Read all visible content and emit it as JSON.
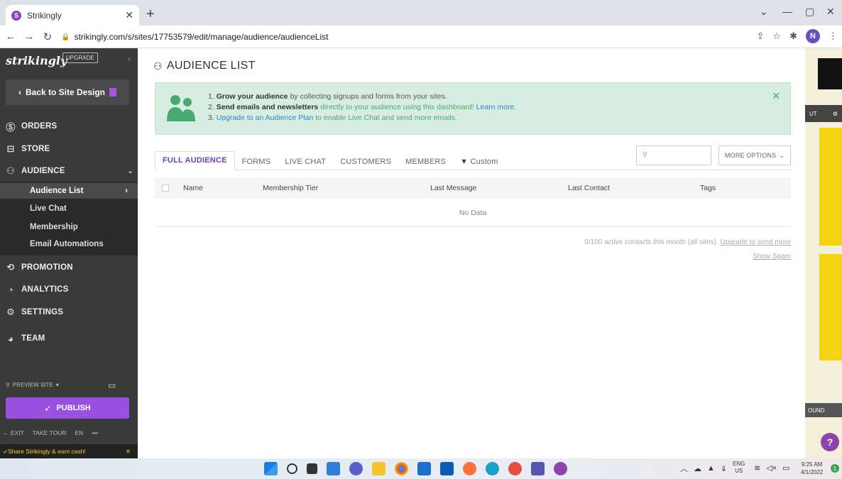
{
  "browser": {
    "tab_title": "Strikingly",
    "tab_favicon_letter": "S",
    "url": "strikingly.com/s/sites/17753579/edit/manage/audience/audienceList",
    "profile_initial": "N"
  },
  "sidebar": {
    "logo": "strikingly",
    "upgrade_label": "UPGRADE",
    "back_label": "Back to Site Design",
    "items": [
      {
        "label": "ORDERS",
        "icon": "dollar-circle-icon"
      },
      {
        "label": "STORE",
        "icon": "store-icon"
      },
      {
        "label": "AUDIENCE",
        "icon": "audience-icon"
      },
      {
        "label": "PROMOTION",
        "icon": "megaphone-icon"
      },
      {
        "label": "ANALYTICS",
        "icon": "analytics-icon"
      },
      {
        "label": "SETTINGS",
        "icon": "gear-icon"
      },
      {
        "label": "TEAM",
        "icon": "team-icon"
      }
    ],
    "audience_sub": [
      "Audience List",
      "Live Chat",
      "Membership",
      "Email Automations"
    ],
    "preview_label": "PREVIEW SITE",
    "publish_label": "PUBLISH",
    "bottom_links": [
      "EXIT",
      "TAKE TOUR",
      "EN",
      "•••"
    ],
    "share_label": "Share Strikingly & earn cash!"
  },
  "main": {
    "title": "AUDIENCE LIST",
    "banner": {
      "line1_num": "1.",
      "line1_bold": "Grow your audience",
      "line1_rest": "by collecting signups and forms from your sites.",
      "line2_num": "2.",
      "line2_bold": "Send emails and newsletters",
      "line2_rest": "directly to your audience using this dashboard!",
      "line2_link": "Learn more.",
      "line3_num": "3.",
      "line3_link": "Upgrade to an Audience Plan",
      "line3_rest": "to enable Live Chat and send more emails."
    },
    "tabs": [
      "FULL AUDIENCE",
      "FORMS",
      "LIVE CHAT",
      "CUSTOMERS",
      "MEMBERS",
      "Custom"
    ],
    "search_placeholder": "",
    "more_options": "MORE OPTIONS",
    "columns": [
      "Name",
      "Membership Tier",
      "Last Message",
      "Last Contact",
      "Tags"
    ],
    "no_data": "No Data",
    "footnote_text": "0/100 active contacts this month (all sites).",
    "footnote_link": "Upgrade to send more",
    "show_spam": "Show Spam"
  },
  "preview": {
    "nav_text": "UT",
    "round_text": "OUND",
    "help": "?"
  },
  "taskbar": {
    "lang_top": "ENG",
    "lang_bottom": "US",
    "time": "9:25 AM",
    "date": "4/1/2022",
    "notif": "1"
  }
}
